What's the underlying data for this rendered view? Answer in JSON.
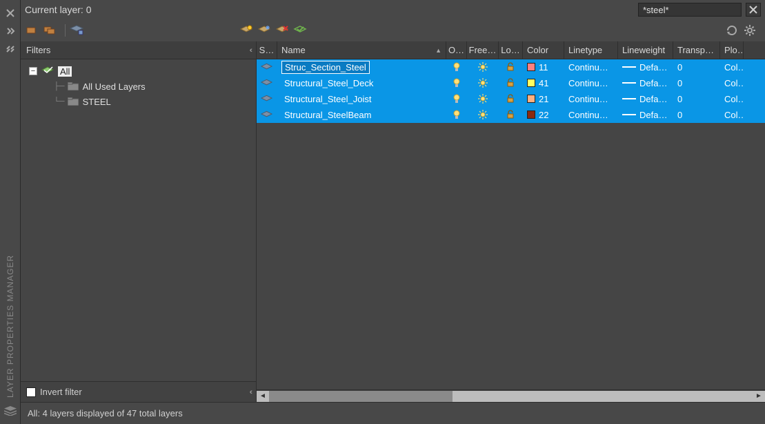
{
  "title_vertical": "LAYER PROPERTIES MANAGER",
  "current_layer_label": "Current layer: 0",
  "search_value": "*steel*",
  "filters": {
    "header": "Filters",
    "invert_label": "Invert filter",
    "tree": {
      "root": "All",
      "children": [
        {
          "label": "All Used Layers"
        },
        {
          "label": "STEEL"
        }
      ]
    }
  },
  "table": {
    "columns": {
      "status": "S…",
      "name": "Name",
      "on": "O…",
      "freeze": "Free…",
      "lock": "Lo…",
      "color": "Color",
      "linetype": "Linetype",
      "lineweight": "Lineweight",
      "transparency": "Transp…",
      "plot": "Plo…"
    },
    "rows": [
      {
        "name": "Struc_Section_Steel",
        "color_index": "11",
        "color_hex": "#ff8080",
        "linetype": "Continu…",
        "lineweight": "Defa…",
        "transparency": "0",
        "plot": "Col…",
        "focused": true
      },
      {
        "name": "Structural_Steel_Deck",
        "color_index": "41",
        "color_hex": "#ffff60",
        "linetype": "Continu…",
        "lineweight": "Defa…",
        "transparency": "0",
        "plot": "Col…",
        "focused": false
      },
      {
        "name": "Structural_Steel_Joist",
        "color_index": "21",
        "color_hex": "#ffb080",
        "linetype": "Continu…",
        "lineweight": "Defa…",
        "transparency": "0",
        "plot": "Col…",
        "focused": false
      },
      {
        "name": "Structural_SteelBeam",
        "color_index": "22",
        "color_hex": "#8b2a0f",
        "linetype": "Continu…",
        "lineweight": "Defa…",
        "transparency": "0",
        "plot": "Col…",
        "focused": false
      }
    ]
  },
  "status_text": "All: 4 layers displayed of 47 total layers"
}
